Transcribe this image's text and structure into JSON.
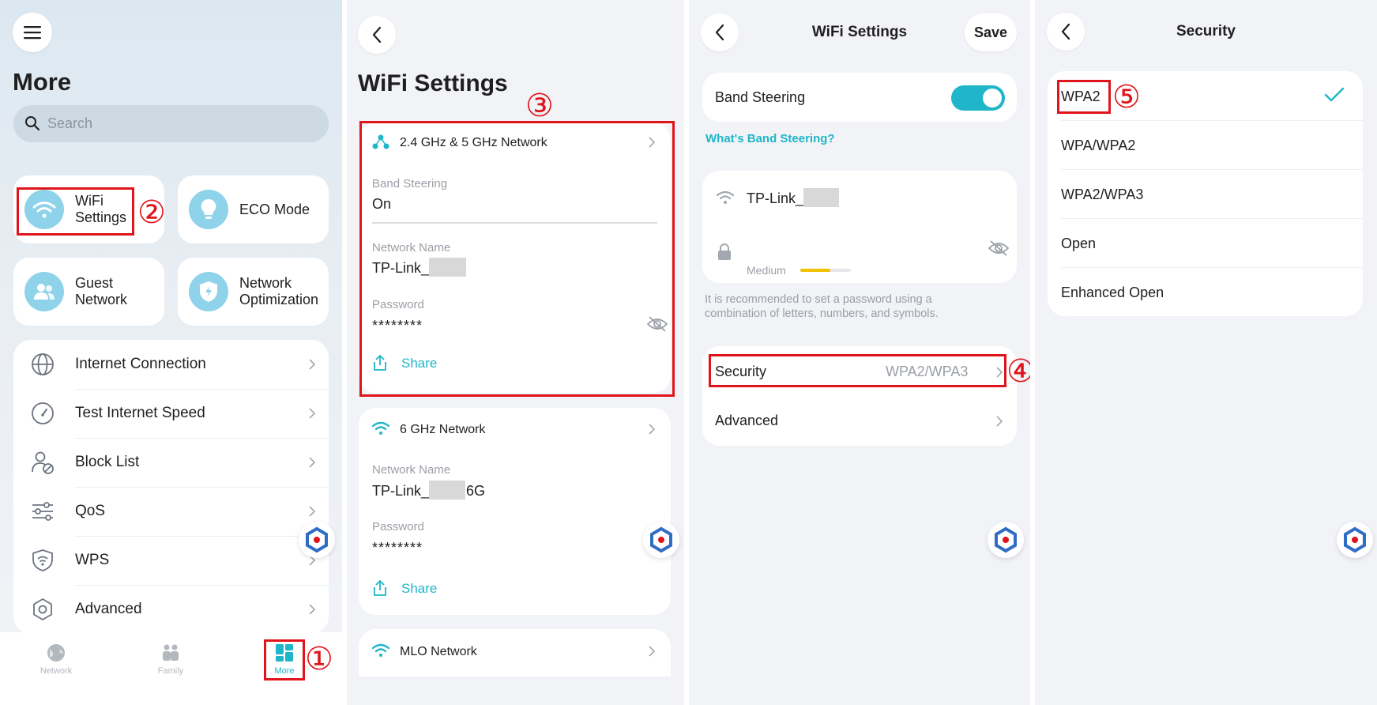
{
  "colors": {
    "accent": "#1eb6c8",
    "annotation": "#e0141b",
    "tile_icon": "#8fd3ea",
    "strength": "#f2c200"
  },
  "panel1": {
    "title": "More",
    "search_placeholder": "Search",
    "tiles": [
      {
        "label": "WiFi\nSettings",
        "icon": "wifi-icon"
      },
      {
        "label": "ECO Mode",
        "icon": "bulb-icon"
      },
      {
        "label": "Guest\nNetwork",
        "icon": "users-icon"
      },
      {
        "label": "Network\nOptimization",
        "icon": "shield-icon"
      }
    ],
    "rows": [
      {
        "label": "Internet Connection",
        "icon": "globe-icon"
      },
      {
        "label": "Test Internet Speed",
        "icon": "gauge-icon"
      },
      {
        "label": "Block List",
        "icon": "block-user-icon"
      },
      {
        "label": "QoS",
        "icon": "sliders-icon"
      },
      {
        "label": "WPS",
        "icon": "wps-shield-icon"
      },
      {
        "label": "Advanced",
        "icon": "hexagon-gear-icon"
      }
    ],
    "tabs": [
      {
        "label": "Network",
        "icon": "globe-tab-icon"
      },
      {
        "label": "Family",
        "icon": "family-icon"
      },
      {
        "label": "More",
        "icon": "grid-icon"
      }
    ],
    "steps": {
      "tab": "①",
      "tile": "②"
    }
  },
  "panel2": {
    "title": "WiFi Settings",
    "step": "③",
    "net1": {
      "name": "2.4 GHz & 5 GHz Network",
      "band_label": "Band Steering",
      "band_value": "On",
      "name_label": "Network Name",
      "name_value": "TP-Link_",
      "pw_label": "Password",
      "pw_value": "********",
      "share": "Share"
    },
    "net2": {
      "name": "6 GHz Network",
      "name_label": "Network Name",
      "name_prefix": "TP-Link_",
      "name_suffix": "6G",
      "pw_label": "Password",
      "pw_value": "********",
      "share": "Share"
    },
    "net3": {
      "name": "MLO Network"
    }
  },
  "panel3": {
    "title": "WiFi Settings",
    "save": "Save",
    "band_label": "Band Steering",
    "band_on": true,
    "help_link": "What's Band Steering?",
    "ssid": "TP-Link_",
    "strength_label": "Medium",
    "strength_level": 0.6,
    "hint": "It is recommended to set a password using a\ncombination of letters, numbers, and symbols.",
    "security_label": "Security",
    "security_value": "WPA2/WPA3",
    "advanced_label": "Advanced",
    "step": "④"
  },
  "panel4": {
    "title": "Security",
    "options": [
      "WPA2",
      "WPA/WPA2",
      "WPA2/WPA3",
      "Open",
      "Enhanced Open"
    ],
    "selected": "WPA2",
    "step": "⑤"
  }
}
